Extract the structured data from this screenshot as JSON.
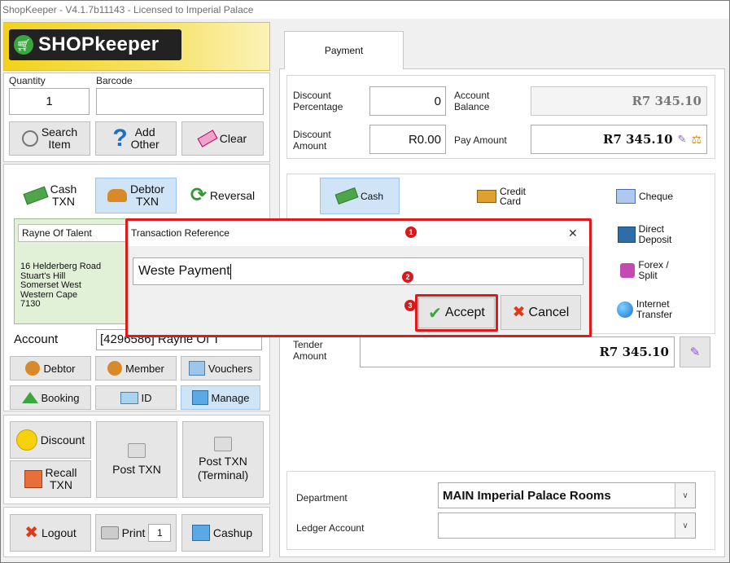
{
  "window": {
    "title": "ShopKeeper - V4.1.7b11143 - Licensed to Imperial Palace"
  },
  "logo": {
    "text": "SHOPkeeper"
  },
  "left": {
    "quantity_label": "Quantity",
    "quantity_value": "1",
    "barcode_label": "Barcode",
    "barcode_value": "",
    "search_label": "Search\nItem",
    "add_other_label": "Add\nOther",
    "clear_label": "Clear",
    "cash_txn_label": "Cash\nTXN",
    "debtor_txn_label": "Debtor\nTXN",
    "reversal_label": "Reversal",
    "debtor_card": {
      "name": "Rayne Of Talent",
      "address": [
        "16 Helderberg Road",
        "Stuart's Hill",
        "Somerset West",
        "Western Cape",
        "7130"
      ]
    },
    "account_label": "Account",
    "account_value": "[4296586] Rayne Of T",
    "debtor_btn": "Debtor",
    "member_btn": "Member",
    "vouchers_btn": "Vouchers",
    "booking_btn": "Booking",
    "id_btn": "ID",
    "manage_btn": "Manage",
    "discount_btn": "Discount",
    "recall_btn": "Recall\nTXN",
    "post_txn_btn": "Post TXN",
    "post_txn_terminal_btn": "Post TXN\n(Terminal)",
    "logout_btn": "Logout",
    "print_btn": "Print",
    "print_copies": "1",
    "cashup_btn": "Cashup"
  },
  "payment": {
    "tab_label": "Payment",
    "discount_pct_label": "Discount\nPercentage",
    "discount_pct_value": "0",
    "account_balance_label": "Account\nBalance",
    "account_balance_value": "R7 345.10",
    "discount_amt_label": "Discount\nAmount",
    "discount_amt_value": "R0.00",
    "pay_amount_label": "Pay Amount",
    "pay_amount_value": "R7 345.10",
    "methods": {
      "cash": "Cash",
      "credit_card": "Credit\nCard",
      "cheque": "Cheque",
      "direct_deposit": "Direct\nDeposit",
      "forex_split": "Forex /\nSplit",
      "internet_transfer": "Internet\nTransfer"
    },
    "tender_label": "Tender\nAmount",
    "tender_value": "R7 345.10",
    "department_label": "Department",
    "department_value": "MAIN Imperial Palace Rooms",
    "ledger_label": "Ledger Account",
    "ledger_value": ""
  },
  "dialog": {
    "title": "Transaction Reference",
    "close_glyph": "✕",
    "input_value": "Weste Payment",
    "accept_label": "Accept",
    "cancel_label": "Cancel"
  },
  "annotations": {
    "step1": "1",
    "step2": "2",
    "step3": "3"
  },
  "colors": {
    "accent_red": "#e0191b",
    "selected_blue": "#cfe4f7",
    "logo_yellow": "#f2d21a"
  }
}
